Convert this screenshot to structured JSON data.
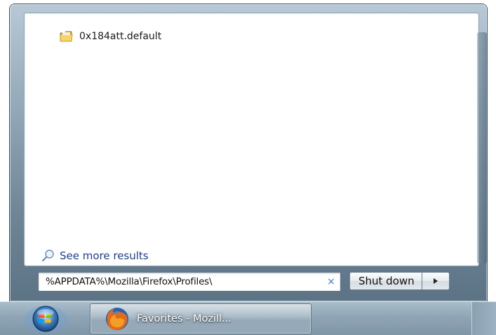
{
  "search_results": {
    "items": [
      {
        "label": "0x184att.default",
        "icon": "folder-icon"
      }
    ],
    "see_more_label": "See more results",
    "see_more_icon": "magnifier-icon"
  },
  "search_box": {
    "value": "%APPDATA%\\Mozilla\\Firefox\\Profiles\\",
    "clear_glyph": "×"
  },
  "shutdown": {
    "label": "Shut down",
    "arrow_icon": "arrow-right-icon"
  },
  "taskbar": {
    "start_icon": "windows-orb-icon",
    "buttons": [
      {
        "label": "Favorites - Mozill...",
        "icon": "firefox-icon"
      }
    ]
  },
  "colors": {
    "link": "#1e3f8a",
    "clear_x": "#3a78c8",
    "taskbar": "#8fa5b5"
  }
}
